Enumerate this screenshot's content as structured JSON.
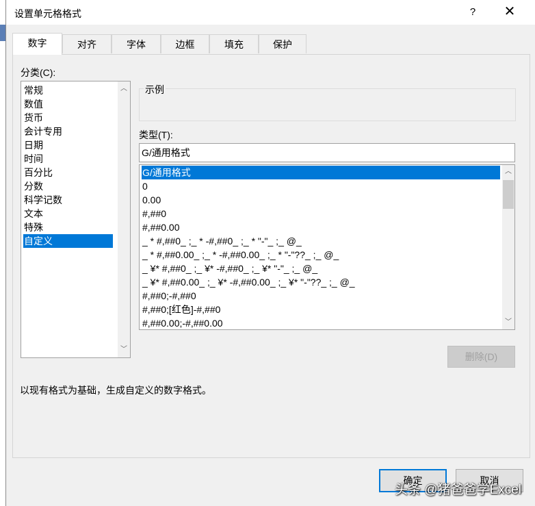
{
  "window": {
    "title": "设置单元格格式",
    "help_label": "?",
    "close_label": "✕"
  },
  "tabs": [
    {
      "label": "数字"
    },
    {
      "label": "对齐"
    },
    {
      "label": "字体"
    },
    {
      "label": "边框"
    },
    {
      "label": "填充"
    },
    {
      "label": "保护"
    }
  ],
  "category": {
    "label": "分类(C):",
    "items": [
      "常规",
      "数值",
      "货币",
      "会计专用",
      "日期",
      "时间",
      "百分比",
      "分数",
      "科学记数",
      "文本",
      "特殊",
      "自定义"
    ],
    "selected": "自定义"
  },
  "sample": {
    "label": "示例",
    "value": ""
  },
  "type": {
    "label": "类型(T):",
    "value": "G/通用格式",
    "items": [
      "G/通用格式",
      "0",
      "0.00",
      "#,##0",
      "#,##0.00",
      "_ * #,##0_ ;_ * -#,##0_ ;_ * \"-\"_ ;_ @_",
      "_ * #,##0.00_ ;_ * -#,##0.00_ ;_ * \"-\"??_ ;_ @_",
      "_ ¥* #,##0_ ;_ ¥* -#,##0_ ;_ ¥* \"-\"_ ;_ @_",
      "_ ¥* #,##0.00_ ;_ ¥* -#,##0.00_ ;_ ¥* \"-\"??_ ;_ @_",
      "#,##0;-#,##0",
      "#,##0;[红色]-#,##0",
      "#,##0.00;-#,##0.00"
    ],
    "selected": "G/通用格式"
  },
  "delete_button": "删除(D)",
  "description": "以现有格式为基础，生成自定义的数字格式。",
  "footer": {
    "ok_label": "确定",
    "cancel_label": "取消"
  },
  "watermark": "头条 @猪爸爸学Excel",
  "colors": {
    "selection": "#0078d7",
    "dialog_bg": "#f0f0f0"
  }
}
